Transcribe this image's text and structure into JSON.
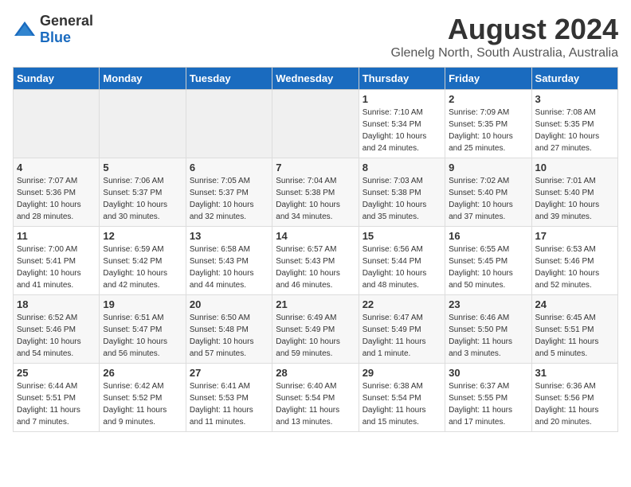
{
  "logo": {
    "general": "General",
    "blue": "Blue"
  },
  "title": "August 2024",
  "subtitle": "Glenelg North, South Australia, Australia",
  "weekdays": [
    "Sunday",
    "Monday",
    "Tuesday",
    "Wednesday",
    "Thursday",
    "Friday",
    "Saturday"
  ],
  "weeks": [
    [
      {
        "day": "",
        "info": ""
      },
      {
        "day": "",
        "info": ""
      },
      {
        "day": "",
        "info": ""
      },
      {
        "day": "",
        "info": ""
      },
      {
        "day": "1",
        "info": "Sunrise: 7:10 AM\nSunset: 5:34 PM\nDaylight: 10 hours\nand 24 minutes."
      },
      {
        "day": "2",
        "info": "Sunrise: 7:09 AM\nSunset: 5:35 PM\nDaylight: 10 hours\nand 25 minutes."
      },
      {
        "day": "3",
        "info": "Sunrise: 7:08 AM\nSunset: 5:35 PM\nDaylight: 10 hours\nand 27 minutes."
      }
    ],
    [
      {
        "day": "4",
        "info": "Sunrise: 7:07 AM\nSunset: 5:36 PM\nDaylight: 10 hours\nand 28 minutes."
      },
      {
        "day": "5",
        "info": "Sunrise: 7:06 AM\nSunset: 5:37 PM\nDaylight: 10 hours\nand 30 minutes."
      },
      {
        "day": "6",
        "info": "Sunrise: 7:05 AM\nSunset: 5:37 PM\nDaylight: 10 hours\nand 32 minutes."
      },
      {
        "day": "7",
        "info": "Sunrise: 7:04 AM\nSunset: 5:38 PM\nDaylight: 10 hours\nand 34 minutes."
      },
      {
        "day": "8",
        "info": "Sunrise: 7:03 AM\nSunset: 5:38 PM\nDaylight: 10 hours\nand 35 minutes."
      },
      {
        "day": "9",
        "info": "Sunrise: 7:02 AM\nSunset: 5:40 PM\nDaylight: 10 hours\nand 37 minutes."
      },
      {
        "day": "10",
        "info": "Sunrise: 7:01 AM\nSunset: 5:40 PM\nDaylight: 10 hours\nand 39 minutes."
      }
    ],
    [
      {
        "day": "11",
        "info": "Sunrise: 7:00 AM\nSunset: 5:41 PM\nDaylight: 10 hours\nand 41 minutes."
      },
      {
        "day": "12",
        "info": "Sunrise: 6:59 AM\nSunset: 5:42 PM\nDaylight: 10 hours\nand 42 minutes."
      },
      {
        "day": "13",
        "info": "Sunrise: 6:58 AM\nSunset: 5:43 PM\nDaylight: 10 hours\nand 44 minutes."
      },
      {
        "day": "14",
        "info": "Sunrise: 6:57 AM\nSunset: 5:43 PM\nDaylight: 10 hours\nand 46 minutes."
      },
      {
        "day": "15",
        "info": "Sunrise: 6:56 AM\nSunset: 5:44 PM\nDaylight: 10 hours\nand 48 minutes."
      },
      {
        "day": "16",
        "info": "Sunrise: 6:55 AM\nSunset: 5:45 PM\nDaylight: 10 hours\nand 50 minutes."
      },
      {
        "day": "17",
        "info": "Sunrise: 6:53 AM\nSunset: 5:46 PM\nDaylight: 10 hours\nand 52 minutes."
      }
    ],
    [
      {
        "day": "18",
        "info": "Sunrise: 6:52 AM\nSunset: 5:46 PM\nDaylight: 10 hours\nand 54 minutes."
      },
      {
        "day": "19",
        "info": "Sunrise: 6:51 AM\nSunset: 5:47 PM\nDaylight: 10 hours\nand 56 minutes."
      },
      {
        "day": "20",
        "info": "Sunrise: 6:50 AM\nSunset: 5:48 PM\nDaylight: 10 hours\nand 57 minutes."
      },
      {
        "day": "21",
        "info": "Sunrise: 6:49 AM\nSunset: 5:49 PM\nDaylight: 10 hours\nand 59 minutes."
      },
      {
        "day": "22",
        "info": "Sunrise: 6:47 AM\nSunset: 5:49 PM\nDaylight: 11 hours\nand 1 minute."
      },
      {
        "day": "23",
        "info": "Sunrise: 6:46 AM\nSunset: 5:50 PM\nDaylight: 11 hours\nand 3 minutes."
      },
      {
        "day": "24",
        "info": "Sunrise: 6:45 AM\nSunset: 5:51 PM\nDaylight: 11 hours\nand 5 minutes."
      }
    ],
    [
      {
        "day": "25",
        "info": "Sunrise: 6:44 AM\nSunset: 5:51 PM\nDaylight: 11 hours\nand 7 minutes."
      },
      {
        "day": "26",
        "info": "Sunrise: 6:42 AM\nSunset: 5:52 PM\nDaylight: 11 hours\nand 9 minutes."
      },
      {
        "day": "27",
        "info": "Sunrise: 6:41 AM\nSunset: 5:53 PM\nDaylight: 11 hours\nand 11 minutes."
      },
      {
        "day": "28",
        "info": "Sunrise: 6:40 AM\nSunset: 5:54 PM\nDaylight: 11 hours\nand 13 minutes."
      },
      {
        "day": "29",
        "info": "Sunrise: 6:38 AM\nSunset: 5:54 PM\nDaylight: 11 hours\nand 15 minutes."
      },
      {
        "day": "30",
        "info": "Sunrise: 6:37 AM\nSunset: 5:55 PM\nDaylight: 11 hours\nand 17 minutes."
      },
      {
        "day": "31",
        "info": "Sunrise: 6:36 AM\nSunset: 5:56 PM\nDaylight: 11 hours\nand 20 minutes."
      }
    ]
  ]
}
